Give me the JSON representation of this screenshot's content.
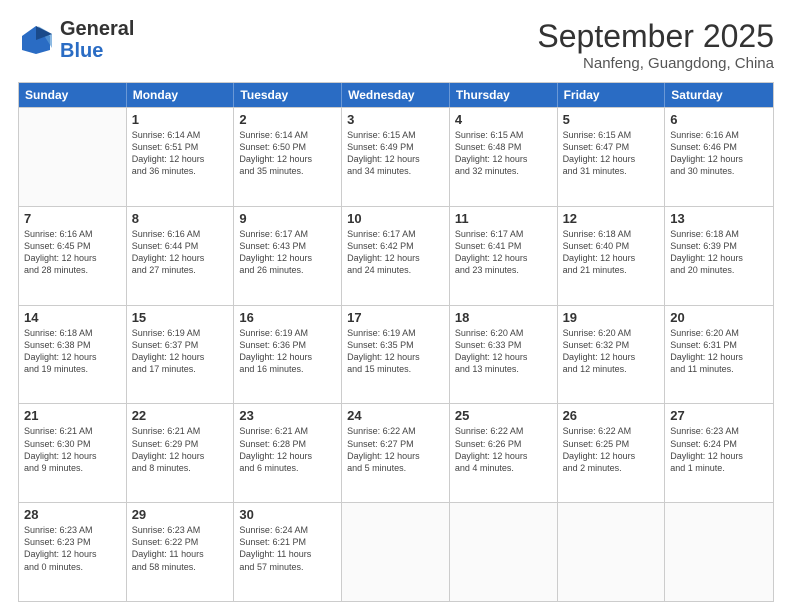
{
  "header": {
    "logo_general": "General",
    "logo_blue": "Blue",
    "month_title": "September 2025",
    "subtitle": "Nanfeng, Guangdong, China"
  },
  "weekdays": [
    "Sunday",
    "Monday",
    "Tuesday",
    "Wednesday",
    "Thursday",
    "Friday",
    "Saturday"
  ],
  "rows": [
    [
      {
        "day": "",
        "text": ""
      },
      {
        "day": "1",
        "text": "Sunrise: 6:14 AM\nSunset: 6:51 PM\nDaylight: 12 hours\nand 36 minutes."
      },
      {
        "day": "2",
        "text": "Sunrise: 6:14 AM\nSunset: 6:50 PM\nDaylight: 12 hours\nand 35 minutes."
      },
      {
        "day": "3",
        "text": "Sunrise: 6:15 AM\nSunset: 6:49 PM\nDaylight: 12 hours\nand 34 minutes."
      },
      {
        "day": "4",
        "text": "Sunrise: 6:15 AM\nSunset: 6:48 PM\nDaylight: 12 hours\nand 32 minutes."
      },
      {
        "day": "5",
        "text": "Sunrise: 6:15 AM\nSunset: 6:47 PM\nDaylight: 12 hours\nand 31 minutes."
      },
      {
        "day": "6",
        "text": "Sunrise: 6:16 AM\nSunset: 6:46 PM\nDaylight: 12 hours\nand 30 minutes."
      }
    ],
    [
      {
        "day": "7",
        "text": "Sunrise: 6:16 AM\nSunset: 6:45 PM\nDaylight: 12 hours\nand 28 minutes."
      },
      {
        "day": "8",
        "text": "Sunrise: 6:16 AM\nSunset: 6:44 PM\nDaylight: 12 hours\nand 27 minutes."
      },
      {
        "day": "9",
        "text": "Sunrise: 6:17 AM\nSunset: 6:43 PM\nDaylight: 12 hours\nand 26 minutes."
      },
      {
        "day": "10",
        "text": "Sunrise: 6:17 AM\nSunset: 6:42 PM\nDaylight: 12 hours\nand 24 minutes."
      },
      {
        "day": "11",
        "text": "Sunrise: 6:17 AM\nSunset: 6:41 PM\nDaylight: 12 hours\nand 23 minutes."
      },
      {
        "day": "12",
        "text": "Sunrise: 6:18 AM\nSunset: 6:40 PM\nDaylight: 12 hours\nand 21 minutes."
      },
      {
        "day": "13",
        "text": "Sunrise: 6:18 AM\nSunset: 6:39 PM\nDaylight: 12 hours\nand 20 minutes."
      }
    ],
    [
      {
        "day": "14",
        "text": "Sunrise: 6:18 AM\nSunset: 6:38 PM\nDaylight: 12 hours\nand 19 minutes."
      },
      {
        "day": "15",
        "text": "Sunrise: 6:19 AM\nSunset: 6:37 PM\nDaylight: 12 hours\nand 17 minutes."
      },
      {
        "day": "16",
        "text": "Sunrise: 6:19 AM\nSunset: 6:36 PM\nDaylight: 12 hours\nand 16 minutes."
      },
      {
        "day": "17",
        "text": "Sunrise: 6:19 AM\nSunset: 6:35 PM\nDaylight: 12 hours\nand 15 minutes."
      },
      {
        "day": "18",
        "text": "Sunrise: 6:20 AM\nSunset: 6:33 PM\nDaylight: 12 hours\nand 13 minutes."
      },
      {
        "day": "19",
        "text": "Sunrise: 6:20 AM\nSunset: 6:32 PM\nDaylight: 12 hours\nand 12 minutes."
      },
      {
        "day": "20",
        "text": "Sunrise: 6:20 AM\nSunset: 6:31 PM\nDaylight: 12 hours\nand 11 minutes."
      }
    ],
    [
      {
        "day": "21",
        "text": "Sunrise: 6:21 AM\nSunset: 6:30 PM\nDaylight: 12 hours\nand 9 minutes."
      },
      {
        "day": "22",
        "text": "Sunrise: 6:21 AM\nSunset: 6:29 PM\nDaylight: 12 hours\nand 8 minutes."
      },
      {
        "day": "23",
        "text": "Sunrise: 6:21 AM\nSunset: 6:28 PM\nDaylight: 12 hours\nand 6 minutes."
      },
      {
        "day": "24",
        "text": "Sunrise: 6:22 AM\nSunset: 6:27 PM\nDaylight: 12 hours\nand 5 minutes."
      },
      {
        "day": "25",
        "text": "Sunrise: 6:22 AM\nSunset: 6:26 PM\nDaylight: 12 hours\nand 4 minutes."
      },
      {
        "day": "26",
        "text": "Sunrise: 6:22 AM\nSunset: 6:25 PM\nDaylight: 12 hours\nand 2 minutes."
      },
      {
        "day": "27",
        "text": "Sunrise: 6:23 AM\nSunset: 6:24 PM\nDaylight: 12 hours\nand 1 minute."
      }
    ],
    [
      {
        "day": "28",
        "text": "Sunrise: 6:23 AM\nSunset: 6:23 PM\nDaylight: 12 hours\nand 0 minutes."
      },
      {
        "day": "29",
        "text": "Sunrise: 6:23 AM\nSunset: 6:22 PM\nDaylight: 11 hours\nand 58 minutes."
      },
      {
        "day": "30",
        "text": "Sunrise: 6:24 AM\nSunset: 6:21 PM\nDaylight: 11 hours\nand 57 minutes."
      },
      {
        "day": "",
        "text": ""
      },
      {
        "day": "",
        "text": ""
      },
      {
        "day": "",
        "text": ""
      },
      {
        "day": "",
        "text": ""
      }
    ]
  ]
}
